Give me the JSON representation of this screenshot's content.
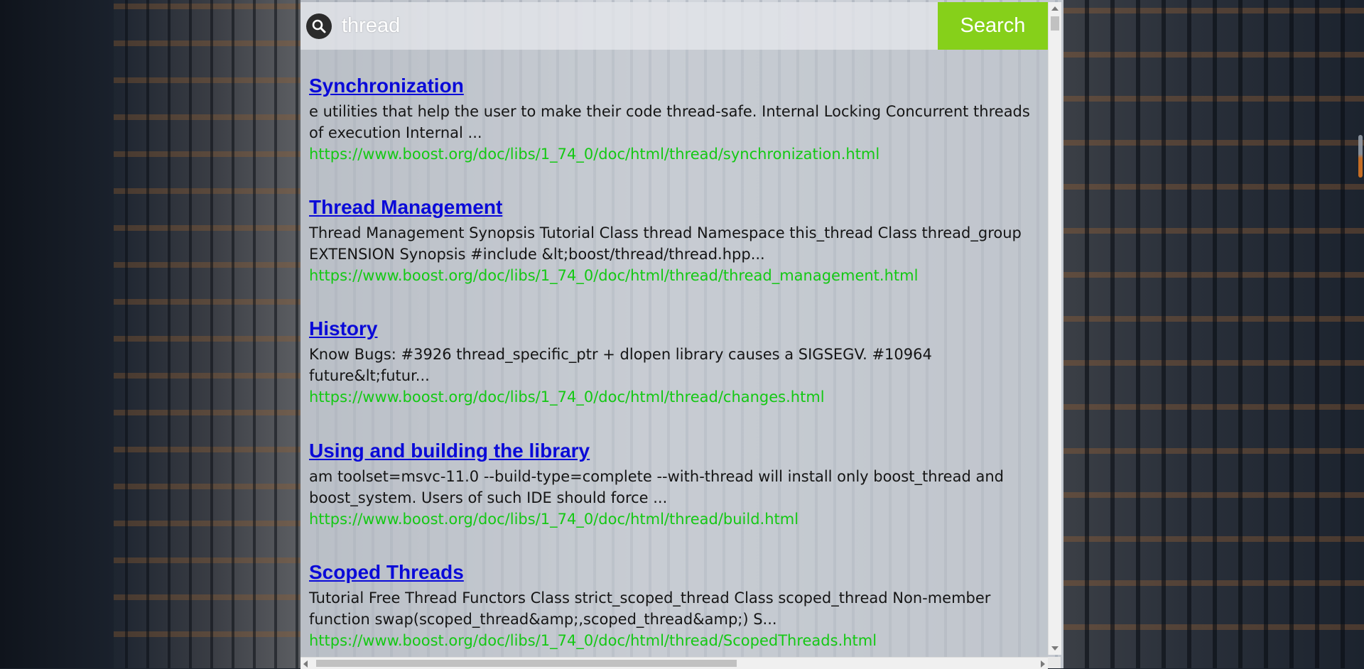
{
  "search": {
    "query": "thread",
    "button_label": "Search"
  },
  "results": [
    {
      "title": "Synchronization",
      "snippet": "e utilities that help the user to make their code thread-safe. Internal Locking Concurrent threads of execution Internal ...",
      "url": "https://www.boost.org/doc/libs/1_74_0/doc/html/thread/synchronization.html"
    },
    {
      "title": "Thread Management",
      "snippet": "Thread Management Synopsis Tutorial Class thread Namespace this_thread Class thread_group EXTENSION Synopsis #include &lt;boost/thread/thread.hpp...",
      "url": "https://www.boost.org/doc/libs/1_74_0/doc/html/thread/thread_management.html"
    },
    {
      "title": "History",
      "snippet": "Know Bugs: #3926 thread_specific_ptr + dlopen library causes a SIGSEGV. #10964 future&lt;futur...",
      "url": "https://www.boost.org/doc/libs/1_74_0/doc/html/thread/changes.html"
    },
    {
      "title": "Using and building the library",
      "snippet": "am toolset=msvc-11.0 --build-type=complete --with-thread will install only boost_thread and boost_system. Users of such IDE should force ...",
      "url": "https://www.boost.org/doc/libs/1_74_0/doc/html/thread/build.html"
    },
    {
      "title": "Scoped Threads",
      "snippet": "Tutorial Free Thread Functors Class strict_scoped_thread Class scoped_thread Non-member function swap(scoped_thread&amp;,scoped_thread&amp;) S...",
      "url": "https://www.boost.org/doc/libs/1_74_0/doc/html/thread/ScopedThreads.html"
    }
  ],
  "colors": {
    "accent": "#86d01a",
    "link": "#0a0ad8",
    "url": "#14c814"
  }
}
